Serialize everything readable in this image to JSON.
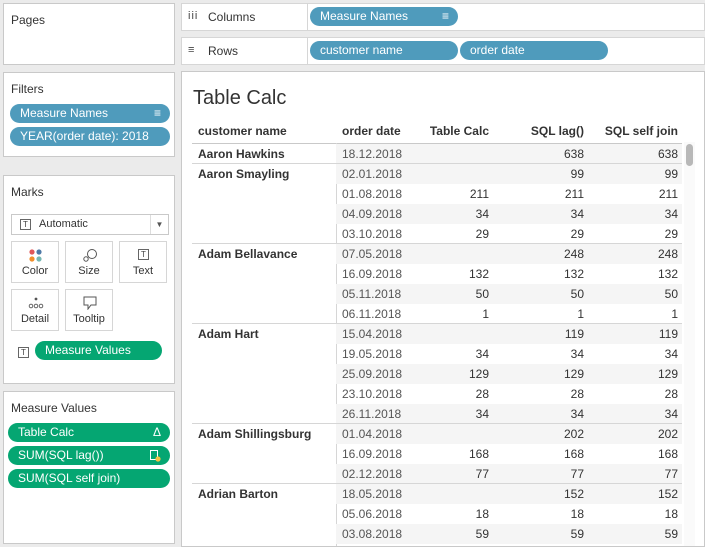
{
  "pages": {
    "title": "Pages"
  },
  "filters": {
    "title": "Filters",
    "items": [
      "Measure Names",
      "YEAR(order date): 2018"
    ]
  },
  "marks": {
    "title": "Marks",
    "type": "Automatic",
    "buttons": [
      "Color",
      "Size",
      "Text",
      "Detail",
      "Tooltip"
    ],
    "text_pill": "Measure Values"
  },
  "measure_values": {
    "title": "Measure Values",
    "items": [
      "Table Calc",
      "SUM(SQL lag())",
      "SUM(SQL self join)"
    ]
  },
  "shelves": {
    "columns_label": "Columns",
    "rows_label": "Rows",
    "columns_pills": [
      "Measure Names"
    ],
    "rows_pills": [
      "customer name",
      "order date"
    ]
  },
  "view": {
    "title": "Table Calc",
    "headers": [
      "customer name",
      "order date",
      "Table Calc",
      "SQL lag()",
      "SQL self join"
    ],
    "groups": [
      {
        "customer": "Aaron Hawkins",
        "rows": [
          {
            "date": "18.12.2018",
            "tc": "",
            "lag": "638",
            "self": "638"
          }
        ]
      },
      {
        "customer": "Aaron Smayling",
        "rows": [
          {
            "date": "02.01.2018",
            "tc": "",
            "lag": "99",
            "self": "99"
          },
          {
            "date": "01.08.2018",
            "tc": "211",
            "lag": "211",
            "self": "211"
          },
          {
            "date": "04.09.2018",
            "tc": "34",
            "lag": "34",
            "self": "34"
          },
          {
            "date": "03.10.2018",
            "tc": "29",
            "lag": "29",
            "self": "29"
          }
        ]
      },
      {
        "customer": "Adam Bellavance",
        "rows": [
          {
            "date": "07.05.2018",
            "tc": "",
            "lag": "248",
            "self": "248"
          },
          {
            "date": "16.09.2018",
            "tc": "132",
            "lag": "132",
            "self": "132"
          },
          {
            "date": "05.11.2018",
            "tc": "50",
            "lag": "50",
            "self": "50"
          },
          {
            "date": "06.11.2018",
            "tc": "1",
            "lag": "1",
            "self": "1"
          }
        ]
      },
      {
        "customer": "Adam Hart",
        "rows": [
          {
            "date": "15.04.2018",
            "tc": "",
            "lag": "119",
            "self": "119"
          },
          {
            "date": "19.05.2018",
            "tc": "34",
            "lag": "34",
            "self": "34"
          },
          {
            "date": "25.09.2018",
            "tc": "129",
            "lag": "129",
            "self": "129"
          },
          {
            "date": "23.10.2018",
            "tc": "28",
            "lag": "28",
            "self": "28"
          },
          {
            "date": "26.11.2018",
            "tc": "34",
            "lag": "34",
            "self": "34"
          }
        ]
      },
      {
        "customer": "Adam Shillingsburg",
        "rows": [
          {
            "date": "01.04.2018",
            "tc": "",
            "lag": "202",
            "self": "202"
          },
          {
            "date": "16.09.2018",
            "tc": "168",
            "lag": "168",
            "self": "168"
          },
          {
            "date": "02.12.2018",
            "tc": "77",
            "lag": "77",
            "self": "77"
          }
        ]
      },
      {
        "customer": "Adrian Barton",
        "rows": [
          {
            "date": "18.05.2018",
            "tc": "",
            "lag": "152",
            "self": "152"
          },
          {
            "date": "05.06.2018",
            "tc": "18",
            "lag": "18",
            "self": "18"
          },
          {
            "date": "03.08.2018",
            "tc": "59",
            "lag": "59",
            "self": "59"
          }
        ]
      }
    ]
  },
  "colors": {
    "dimension_pill": "#4f9bbc",
    "measure_pill": "#05a672"
  },
  "icons": {
    "columns": "columns-icon",
    "rows": "rows-icon",
    "sort": "sort-icon",
    "delta": "delta-icon",
    "tableau_calc": "calc-icon",
    "text_mark": "text-mark-icon"
  }
}
